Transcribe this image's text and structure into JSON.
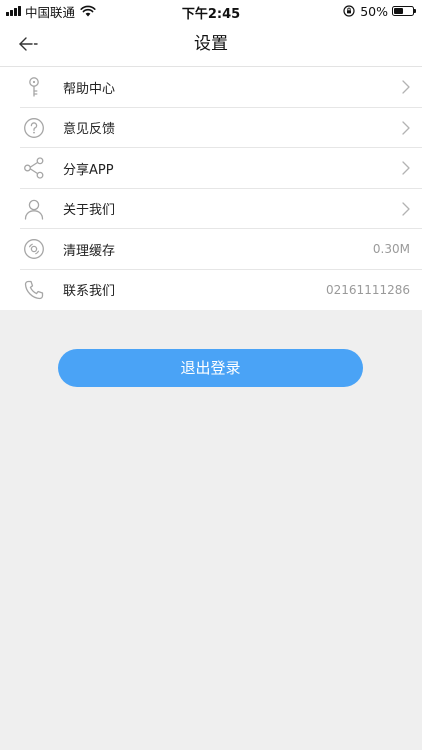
{
  "status_bar": {
    "carrier": "中国联通",
    "time": "下午2:45",
    "battery": "50%",
    "battery_level": 0.5
  },
  "nav": {
    "title": "设置",
    "back_icon": "back-arrow-icon"
  },
  "settings": {
    "items": [
      {
        "label": "帮助中心",
        "icon": "key-icon",
        "value": ""
      },
      {
        "label": "意见反馈",
        "icon": "question-circle-icon",
        "value": ""
      },
      {
        "label": "分享APP",
        "icon": "share-icon",
        "value": ""
      },
      {
        "label": "关于我们",
        "icon": "person-icon",
        "value": ""
      },
      {
        "label": "清理缓存",
        "icon": "disc-icon",
        "value": "0.30M"
      },
      {
        "label": "联系我们",
        "icon": "phone-icon",
        "value": "02161111286"
      }
    ]
  },
  "logout": {
    "label": "退出登录"
  },
  "colors": {
    "accent": "#4aa3f6",
    "background": "#efefef",
    "icon_gray": "#a6a6a6"
  }
}
